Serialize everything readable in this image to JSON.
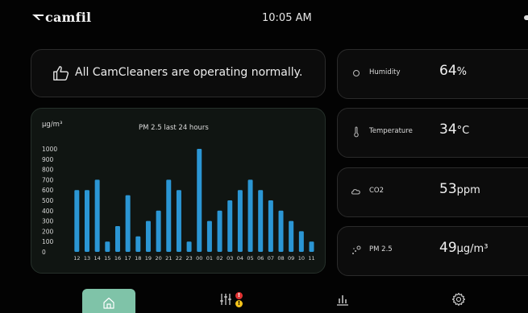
{
  "header": {
    "brand": "camfil",
    "time": "10:05 AM"
  },
  "status": {
    "message": "All CamCleaners are operating normally."
  },
  "chart_data": {
    "type": "bar",
    "title": "PM 2.5 last 24 hours",
    "ylabel": "µg/m³",
    "xlabel": "",
    "ylim": [
      0,
      1000
    ],
    "yticks": [
      "1000",
      "900",
      "800",
      "700",
      "600",
      "500",
      "400",
      "300",
      "200",
      "100",
      "0"
    ],
    "categories": [
      "12",
      "13",
      "14",
      "15",
      "16",
      "17",
      "18",
      "19",
      "20",
      "21",
      "22",
      "23",
      "00",
      "01",
      "02",
      "03",
      "04",
      "05",
      "06",
      "07",
      "08",
      "09",
      "10",
      "11"
    ],
    "values": [
      600,
      600,
      700,
      100,
      250,
      550,
      150,
      300,
      400,
      700,
      600,
      100,
      1000,
      300,
      400,
      500,
      600,
      700,
      600,
      500,
      400,
      300,
      200,
      100
    ],
    "bar_color": "#2b96d4",
    "grid": false
  },
  "metrics": [
    {
      "icon": "humidity-icon",
      "label": "Humidity",
      "value": "64",
      "unit": "%"
    },
    {
      "icon": "thermometer-icon",
      "label": "Temperature",
      "value": "34",
      "unit": "°C"
    },
    {
      "icon": "co2-icon",
      "label": "CO2",
      "value": "53",
      "unit": "ppm"
    },
    {
      "icon": "particles-icon",
      "label": "PM 2.5",
      "value": "49",
      "unit": "µg/m³"
    }
  ],
  "nav": {
    "alert_red": "!",
    "alert_yellow": "!"
  },
  "colors": {
    "accent": "#7fc3a8",
    "bar": "#2b96d4",
    "background": "#030303"
  }
}
